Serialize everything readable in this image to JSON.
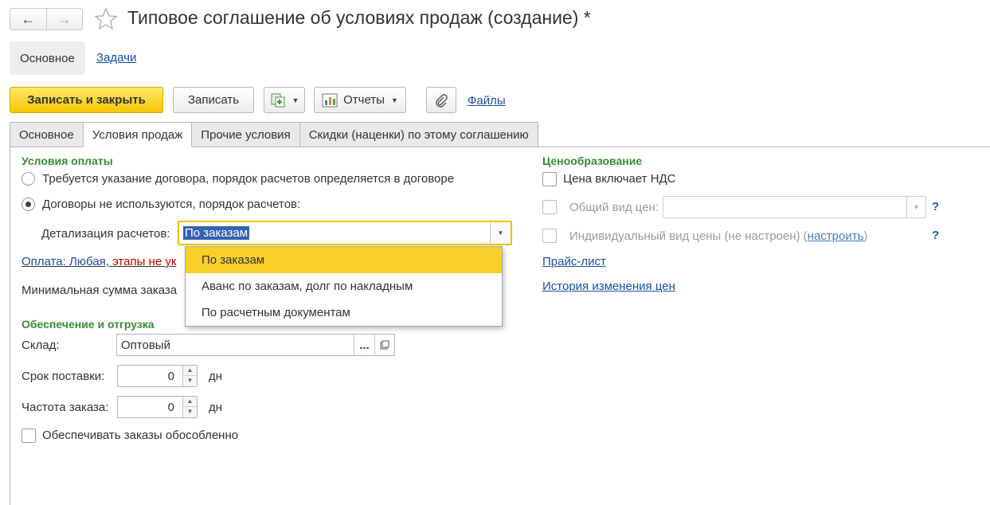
{
  "window": {
    "title": "Типовое соглашение об условиях продаж (создание) *",
    "back_icon": "←",
    "forward_icon": "→"
  },
  "panel_tabs": {
    "main": "Основное",
    "tasks": "Задачи"
  },
  "toolbar": {
    "save_close": "Записать и закрыть",
    "save": "Записать",
    "reports": "Отчеты",
    "files": "Файлы"
  },
  "tabs": [
    "Основное",
    "Условия продаж",
    "Прочие условия",
    "Скидки (наценки) по этому соглашению"
  ],
  "payment": {
    "group_title": "Условия оплаты",
    "option1": "Требуется указание договора, порядок расчетов определяется в договоре",
    "option2": "Договоры не используются, порядок расчетов:",
    "detail_label": "Детализация расчетов:",
    "detail_value": "По заказам",
    "payment_link_blue": "Оплата: Любая,",
    "payment_link_red": "этапы не ук",
    "min_sum_label": "Минимальная сумма заказа"
  },
  "dropdown": {
    "items": [
      "По заказам",
      "Аванс по заказам, долг по накладным",
      "По расчетным документам"
    ]
  },
  "shipping": {
    "group_title": "Обеспечение и отгрузка",
    "warehouse_label": "Склад:",
    "warehouse_value": "Оптовый",
    "delivery_label": "Срок поставки:",
    "delivery_value": "0",
    "frequency_label": "Частота заказа:",
    "frequency_value": "0",
    "unit": "дн",
    "separate_label": "Обеспечивать заказы обособленно"
  },
  "pricing": {
    "group_title": "Ценообразование",
    "vat_label": "Цена включает НДС",
    "common_price_label": "Общий вид цен:",
    "individual_label_pre": "Индивидуальный вид цены (не настроен) (",
    "configure_link": "настроить",
    "individual_label_post": ")",
    "help": "?",
    "price_list_link": "Прайс-лист",
    "history_link": "История изменения цен"
  },
  "colors": {
    "accent_yellow": "#f5c800",
    "group_green": "#3a8a3a",
    "link_blue": "#1a4ea1",
    "warning_red": "#c00000"
  }
}
